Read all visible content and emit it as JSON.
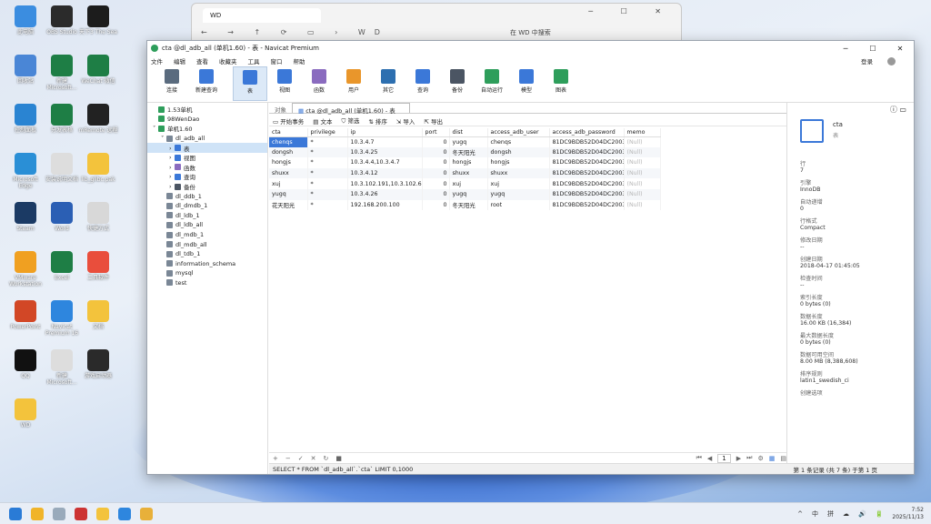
{
  "desktop": {
    "icons": [
      {
        "label": "此电脑",
        "color": "#3b8de0"
      },
      {
        "label": "OBS Studio",
        "color": "#2b2b2b"
      },
      {
        "label": "天下3 The Sea",
        "color": "#1c1c1c"
      },
      {
        "label": "回收站",
        "color": "#4a86d6"
      },
      {
        "label": "新建 Microsoft...",
        "color": "#1e7e45"
      },
      {
        "label": "WeChat 微信",
        "color": "#1e7e45"
      },
      {
        "label": "控制面板",
        "color": "#2a84d2"
      },
      {
        "label": "分发表格",
        "color": "#1e7e45"
      },
      {
        "label": "mRemote 远程",
        "color": "#222"
      },
      {
        "label": "Microsoft Edge",
        "color": "#2a8fd6"
      },
      {
        "label": "安装说明文档",
        "color": "#ddd"
      },
      {
        "label": "lib_glibc.pak",
        "color": "#f3c33c"
      },
      {
        "label": "Steam",
        "color": "#1b3a64"
      },
      {
        "label": "Word",
        "color": "#2b5fb4"
      },
      {
        "label": "快捷方式",
        "color": "#d8d8d8"
      },
      {
        "label": "VMware Workstation",
        "color": "#f0a021"
      },
      {
        "label": "Excel",
        "color": "#1e7e45"
      },
      {
        "label": "工具软件",
        "color": "#e94e3c"
      },
      {
        "label": "PowerPoint",
        "color": "#d24726"
      },
      {
        "label": "Navicat Premium 16",
        "color": "#2e86de"
      },
      {
        "label": "文档",
        "color": "#f3c33c"
      },
      {
        "label": "QQ",
        "color": "#111"
      },
      {
        "label": "新建 Microsoft...",
        "color": "#ddd"
      },
      {
        "label": "游戏启动器",
        "color": "#2a2a2a"
      },
      {
        "label": "WD",
        "color": "#f3c33c"
      }
    ]
  },
  "explorer": {
    "tab_title": "WD",
    "address": "WD",
    "search_placeholder": "在 WD 中搜索"
  },
  "navicat": {
    "title": "cta @dl_adb_all (单机1.60) - 表 - Navicat Premium",
    "menu": [
      "文件",
      "编辑",
      "查看",
      "收藏夹",
      "工具",
      "窗口",
      "帮助"
    ],
    "login_label": "登录",
    "toolbar": [
      {
        "label": "连接",
        "color": "#5a6b7e"
      },
      {
        "label": "新建查询",
        "color": "#3b78d8"
      },
      {
        "label": "表",
        "color": "#3b78d8"
      },
      {
        "label": "视图",
        "color": "#3b78d8"
      },
      {
        "label": "函数",
        "color": "#8a6bbf"
      },
      {
        "label": "用户",
        "color": "#e9962b"
      },
      {
        "label": "其它",
        "color": "#2d6fb0"
      },
      {
        "label": "查询",
        "color": "#3b78d8"
      },
      {
        "label": "备份",
        "color": "#4b5563"
      },
      {
        "label": "自动运行",
        "color": "#2e9e5b"
      },
      {
        "label": "模型",
        "color": "#3b78d8"
      },
      {
        "label": "图表",
        "color": "#2e9e5b"
      }
    ],
    "tree": [
      {
        "label": "1.53单机",
        "indent": 0,
        "color": "#2e9e5b"
      },
      {
        "label": "98WenDao",
        "indent": 0,
        "color": "#2e9e5b"
      },
      {
        "label": "单机1.60",
        "indent": 0,
        "color": "#2e9e5b"
      },
      {
        "label": "dl_adb_all",
        "indent": 1,
        "color": "#7a8796"
      },
      {
        "label": "表",
        "indent": 2,
        "color": "#3b78d8",
        "selected": true
      },
      {
        "label": "视图",
        "indent": 2,
        "color": "#3b78d8"
      },
      {
        "label": "函数",
        "indent": 2,
        "color": "#8a6bbf"
      },
      {
        "label": "查询",
        "indent": 2,
        "color": "#3b78d8"
      },
      {
        "label": "备份",
        "indent": 2,
        "color": "#4b5563"
      },
      {
        "label": "dl_ddb_1",
        "indent": 1,
        "color": "#7a8796"
      },
      {
        "label": "dl_dmdb_1",
        "indent": 1,
        "color": "#7a8796"
      },
      {
        "label": "dl_ldb_1",
        "indent": 1,
        "color": "#7a8796"
      },
      {
        "label": "dl_ldb_all",
        "indent": 1,
        "color": "#7a8796"
      },
      {
        "label": "dl_mdb_1",
        "indent": 1,
        "color": "#7a8796"
      },
      {
        "label": "dl_mdb_all",
        "indent": 1,
        "color": "#7a8796"
      },
      {
        "label": "dl_tdb_1",
        "indent": 1,
        "color": "#7a8796"
      },
      {
        "label": "information_schema",
        "indent": 1,
        "color": "#7a8796"
      },
      {
        "label": "mysql",
        "indent": 1,
        "color": "#7a8796"
      },
      {
        "label": "test",
        "indent": 1,
        "color": "#7a8796"
      }
    ],
    "tabs": {
      "objects": "对象",
      "active": "cta @dl_adb_all (单机1.60) - 表"
    },
    "actions": [
      "开始事务",
      "文本",
      "筛选",
      "排序",
      "导入",
      "导出"
    ],
    "columns": [
      "cta",
      "privilege",
      "ip",
      "port",
      "dist",
      "access_adb_user",
      "access_adb_password",
      "memo"
    ],
    "rows": [
      [
        "chenqs",
        "*",
        "10.3.4.7",
        "0",
        "yugq",
        "chenqs",
        "81DC9BDB52D04DC2003",
        ""
      ],
      [
        "dongsh",
        "*",
        "10.3.4.25",
        "0",
        "冬天阳光",
        "dongsh",
        "81DC9BDB52D04DC2003",
        ""
      ],
      [
        "hongjs",
        "*",
        "10.3.4.4,10.3.4.7",
        "0",
        "hongjs",
        "hongjs",
        "81DC9BDB52D04DC2003",
        ""
      ],
      [
        "shuxx",
        "*",
        "10.3.4.12",
        "0",
        "shuxx",
        "shuxx",
        "81DC9BDB52D04DC2003",
        ""
      ],
      [
        "xuj",
        "*",
        "10.3.102.191,10.3.102.62",
        "0",
        "xuj",
        "xuj",
        "81DC9BDB52D04DC2003",
        ""
      ],
      [
        "yugq",
        "*",
        "10.3.4.26",
        "0",
        "yugq",
        "yugq",
        "81DC9BDB52D04DC2003",
        ""
      ],
      [
        "花天阳光",
        "*",
        "192.168.200.100",
        "0",
        "冬天阳光",
        "root",
        "81DC9BDB52D04DC2003",
        ""
      ]
    ],
    "null_label": "(Null)",
    "bottom_controls": [
      "+",
      "−",
      "✓",
      "✕",
      "↻",
      "■"
    ],
    "pager": {
      "first": "⏮",
      "prev": "◀",
      "page": "1",
      "next": "▶",
      "last": "⏭",
      "settings": "⚙"
    },
    "status_sql": "SELECT * FROM `dl_adb_all`.`cta` LIMIT 0,1000",
    "status_records": "第 1 条记录 (共 7 条) 于第 1 页",
    "info": {
      "name": "cta",
      "sub": "表",
      "fields": [
        {
          "k": "行",
          "v": "7"
        },
        {
          "k": "引擎",
          "v": "InnoDB"
        },
        {
          "k": "自动递增",
          "v": "0"
        },
        {
          "k": "行格式",
          "v": "Compact"
        },
        {
          "k": "修改日期",
          "v": "--"
        },
        {
          "k": "创建日期",
          "v": "2018-04-17 01:45:05"
        },
        {
          "k": "检查时间",
          "v": "--"
        },
        {
          "k": "索引长度",
          "v": "0 bytes (0)"
        },
        {
          "k": "数据长度",
          "v": "16.00 KB (16,384)"
        },
        {
          "k": "最大数据长度",
          "v": "0 bytes (0)"
        },
        {
          "k": "数据可用空间",
          "v": "8.00 MB (8,388,608)"
        },
        {
          "k": "排序规则",
          "v": "latin1_swedish_ci"
        },
        {
          "k": "创建选项",
          "v": ""
        }
      ]
    }
  },
  "taskbar": {
    "tray": [
      "^",
      "中",
      "拼",
      "☁",
      "🔊",
      "🔋"
    ],
    "time": "7:52",
    "date": "2025/11/13"
  }
}
